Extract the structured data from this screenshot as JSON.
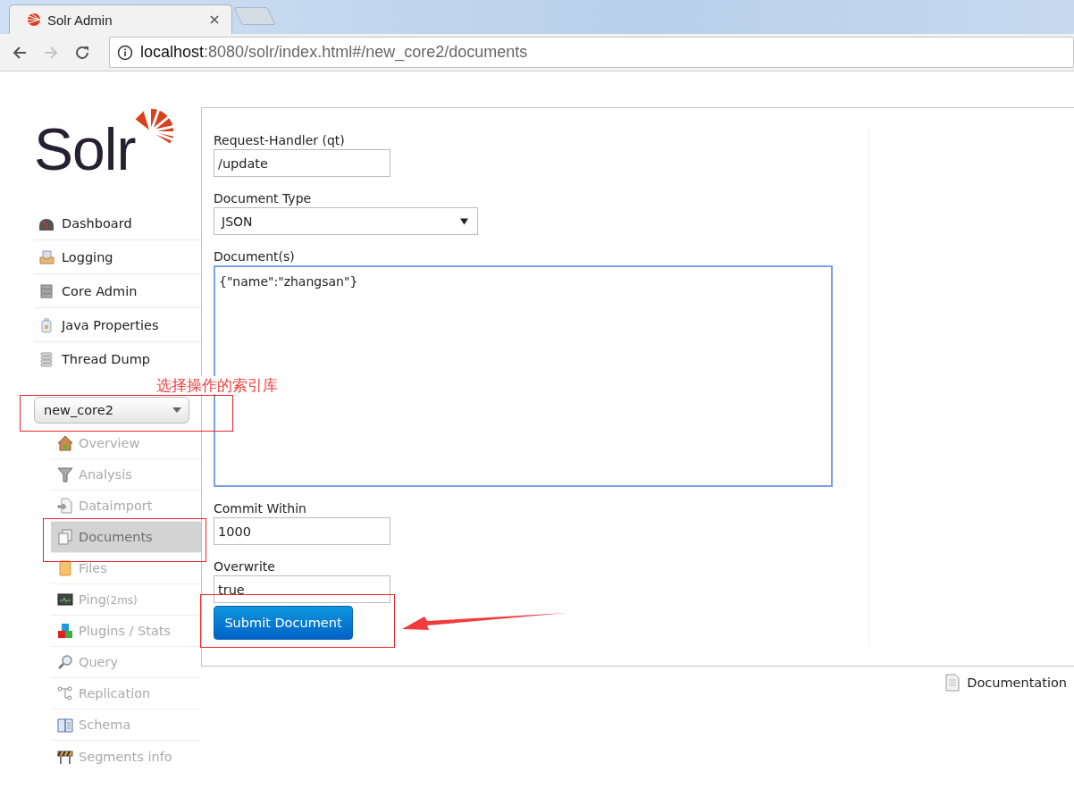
{
  "browser": {
    "tab_title": "Solr Admin",
    "url_host": "localhost",
    "url_rest": ":8080/solr/index.html#/new_core2/documents"
  },
  "logo": {
    "text": "Solr"
  },
  "nav": [
    {
      "label": "Dashboard",
      "kind": "dashboard"
    },
    {
      "label": "Logging",
      "kind": "logging"
    },
    {
      "label": "Core Admin",
      "kind": "core-admin"
    },
    {
      "label": "Java Properties",
      "kind": "java"
    },
    {
      "label": "Thread Dump",
      "kind": "threads"
    }
  ],
  "core_selector": {
    "value": "new_core2"
  },
  "core_menu": [
    {
      "label": "Overview",
      "kind": "overview",
      "selected": false
    },
    {
      "label": "Analysis",
      "kind": "analysis",
      "selected": false
    },
    {
      "label": "Dataimport",
      "kind": "dataimport",
      "selected": false
    },
    {
      "label": "Documents",
      "kind": "documents",
      "selected": true
    },
    {
      "label": "Files",
      "kind": "files",
      "selected": false
    },
    {
      "label": "Ping",
      "note": "(2ms)",
      "kind": "ping",
      "selected": false
    },
    {
      "label": "Plugins / Stats",
      "kind": "plugins",
      "selected": false
    },
    {
      "label": "Query",
      "kind": "query",
      "selected": false
    },
    {
      "label": "Replication",
      "kind": "replication",
      "selected": false
    },
    {
      "label": "Schema",
      "kind": "schema",
      "selected": false
    },
    {
      "label": "Segments info",
      "kind": "segments",
      "selected": false
    }
  ],
  "form": {
    "request_handler": {
      "label": "Request-Handler (qt)",
      "value": "/update"
    },
    "document_type": {
      "label": "Document Type",
      "value": "JSON"
    },
    "documents": {
      "label": "Document(s)",
      "value": "{\"name\":\"zhangsan\"}",
      "focused": true
    },
    "commit_within": {
      "label": "Commit Within",
      "value": "1000"
    },
    "overwrite": {
      "label": "Overwrite",
      "value": "true"
    },
    "submit_button": "Submit Document"
  },
  "footer": {
    "documentation": "Documentation"
  },
  "annotation": {
    "note": "选择操作的索引库"
  }
}
